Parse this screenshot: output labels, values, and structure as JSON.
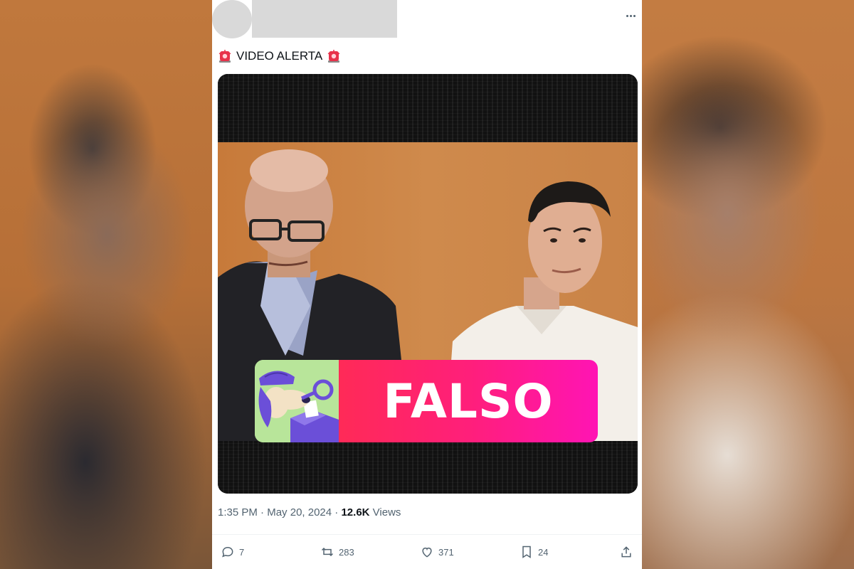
{
  "tweet": {
    "text_label": "VIDEO ALERTA",
    "siren_icon": "police-light-emoji",
    "badge_label": "FALSO",
    "time": "1:35 PM",
    "separator": "·",
    "date": "May 20, 2024",
    "views_count": "12.6K",
    "views_label": "Views"
  },
  "actions": {
    "replies": "7",
    "reposts": "283",
    "likes": "371",
    "bookmarks": "24"
  },
  "colors": {
    "badge_gradient_start": "#ff2a57",
    "badge_gradient_end": "#ff14b4",
    "logo_bg": "#b8e59a",
    "text_secondary": "#536471"
  }
}
